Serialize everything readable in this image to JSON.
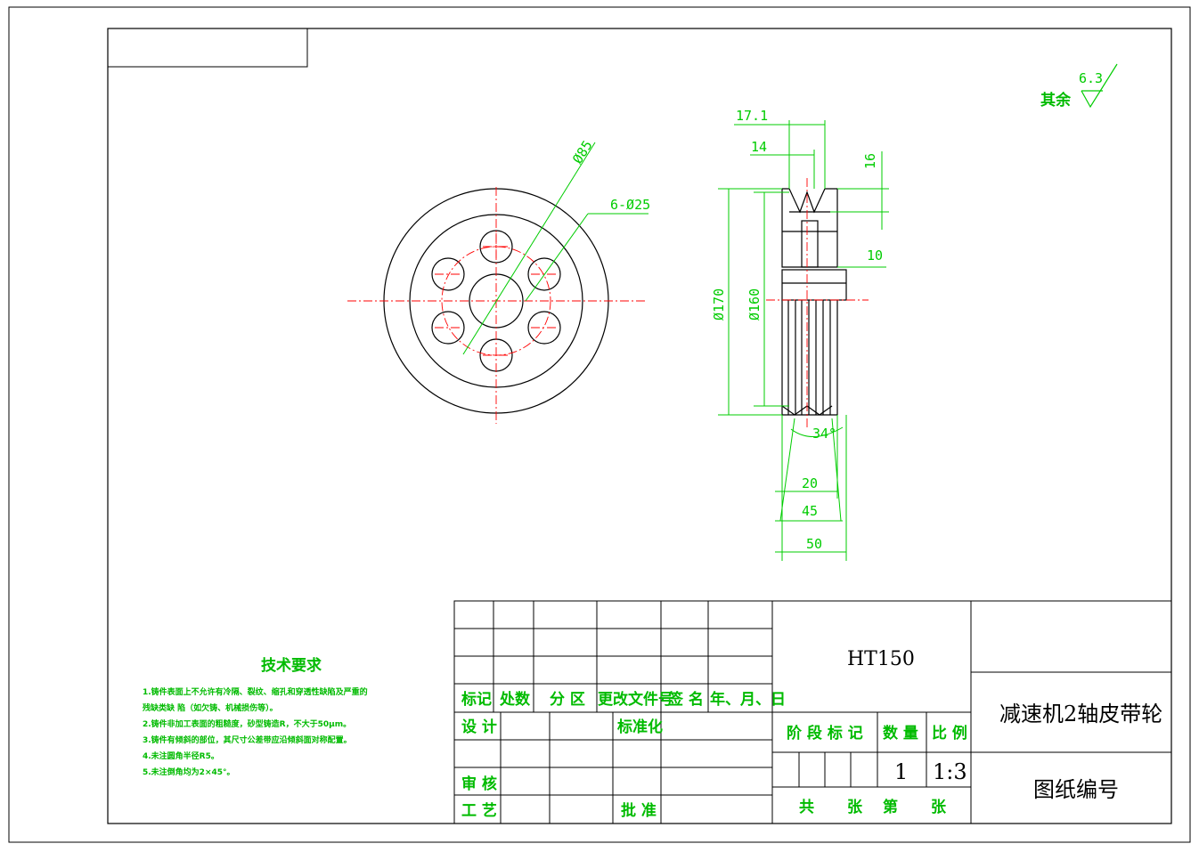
{
  "roughness": {
    "label": "其余",
    "value": "6.3"
  },
  "dimensions": {
    "d_bolt_circle": "Ø85",
    "holes": "6-Ø25",
    "w_17_1": "17.1",
    "w_14": "14",
    "h_16": "16",
    "h_10": "10",
    "d_170": "Ø170",
    "d_160": "Ø160",
    "angle": "34°",
    "w_20": "20",
    "w_45": "45",
    "w_50": "50"
  },
  "tech_requirements": {
    "title": "技术要求",
    "items": [
      "1.铸件表面上不允许有冷隔、裂纹、缩孔和穿透性缺陷及严重的",
      "   残缺类缺  陷（如欠铸、机械损伤等）。",
      "2.铸件非加工表面的粗糙度，砂型铸造R，不大于50μm。",
      "3.铸件有倾斜的部位，其尺寸公差带应沿倾斜面对称配置。",
      "4.未注圆角半径R5。",
      "5.未注倒角均为2×45°。"
    ]
  },
  "title_block": {
    "material": "HT150",
    "part_name": "减速机2轴皮带轮",
    "drawing_no_label": "图纸编号",
    "rev_headers": [
      "标记",
      "处数",
      "分 区",
      "更改文件号",
      "签 名",
      "年、月、日"
    ],
    "design": "设 计",
    "standardization": "标准化",
    "review": "审 核",
    "process": "工 艺",
    "approve": "批 准",
    "stage_mark": "阶 段 标 记",
    "quantity_label": "数 量",
    "scale_label": "比 例",
    "quantity": "1",
    "scale": "1:3",
    "sheets": [
      "共",
      "张",
      "第",
      "张"
    ]
  },
  "colors": {
    "outline": "#000000",
    "dimension": "#00cc00",
    "centerline": "#ff0000"
  }
}
